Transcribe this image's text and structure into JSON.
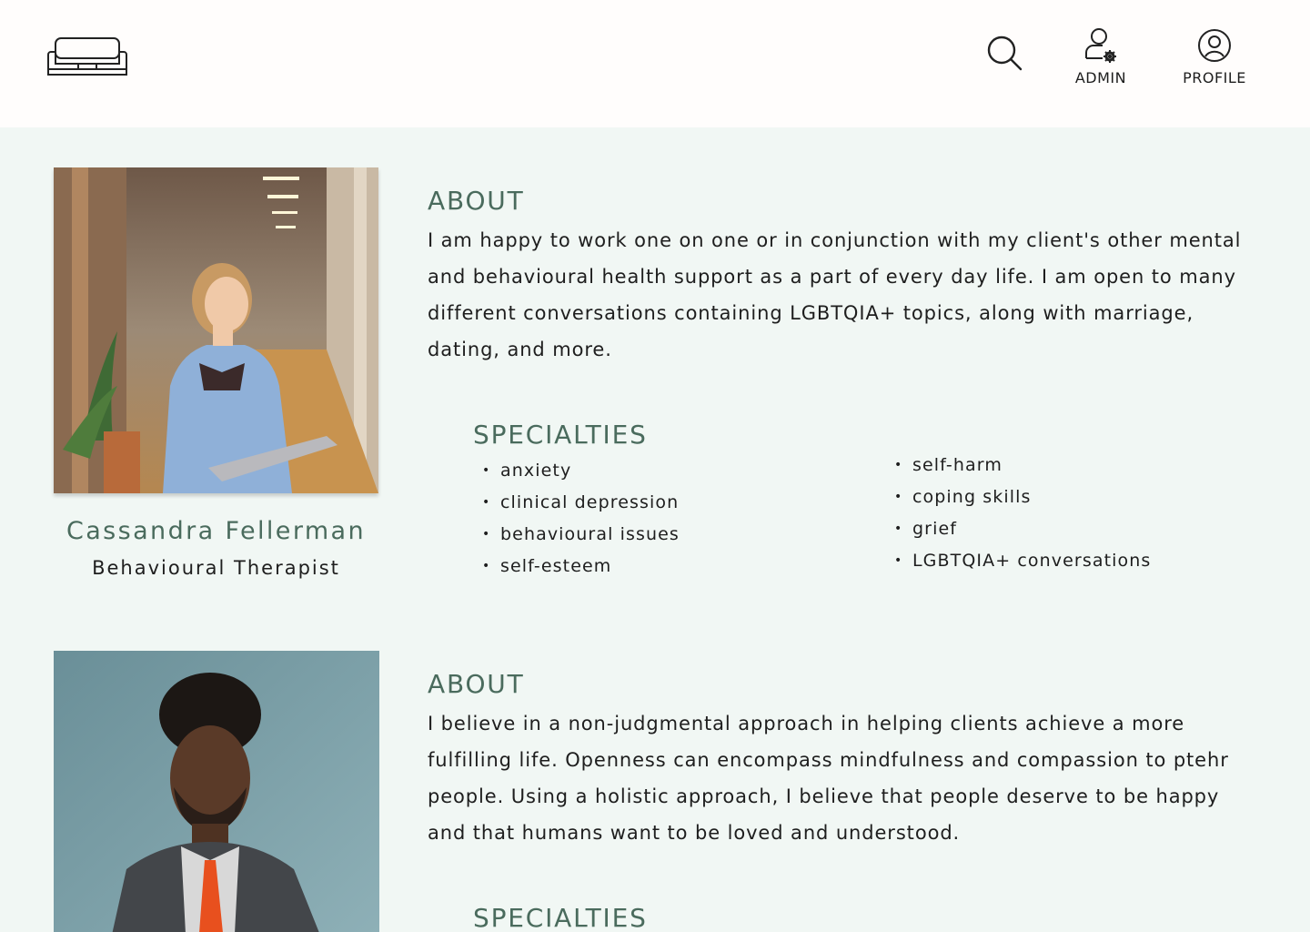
{
  "header": {
    "logo_icon": "sofa-icon",
    "search_icon": "search-icon",
    "admin_label": "ADMIN",
    "admin_icon": "user-gear-icon",
    "profile_label": "PROFILE",
    "profile_icon": "user-circle-icon"
  },
  "colors": {
    "accent": "#4a6b5d",
    "background": "#f1f7f4",
    "header_background": "#fffdfc",
    "text": "#1e1e1e"
  },
  "therapists": [
    {
      "name": "Cassandra Fellerman",
      "role": "Behavioural Therapist",
      "about_title": "ABOUT",
      "about_text": "I am happy to work one on one or in conjunction with my client's other mental and behavioural health support as a part of every day life. I am open to many different conversations containing LGBTQIA+ topics, along with marriage, dating, and more.",
      "specialties_title": "SPECIALTIES",
      "specialties_col1": [
        "anxiety",
        "clinical depression",
        "behavioural issues",
        "self-esteem"
      ],
      "specialties_col2": [
        "self-harm",
        "coping skills",
        "grief",
        "LGBTQIA+ conversations"
      ]
    },
    {
      "about_title": "ABOUT",
      "about_text": "I believe in a non-judgmental approach in helping clients achieve a more fulfilling life. Openness can encompass mindfulness and compassion to ptehr people. Using a holistic approach, I believe that people deserve to be happy and that humans want to be loved and understood.",
      "specialties_title": "SPECIALTIES"
    }
  ]
}
